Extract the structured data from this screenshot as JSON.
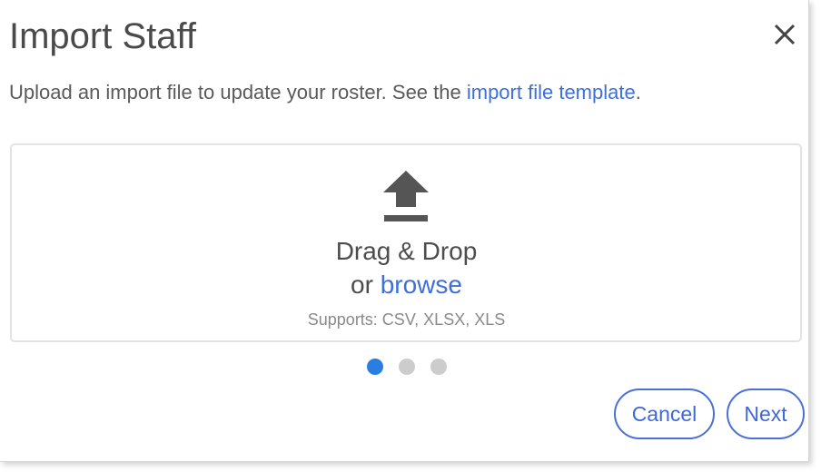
{
  "dialog": {
    "title": "Import Staff",
    "close_icon": "close-icon",
    "subtitle_text": "Upload an import file to update your roster. See the ",
    "subtitle_link": "import file template",
    "subtitle_end": "."
  },
  "dropzone": {
    "icon": "upload-icon",
    "drag_text": "Drag & Drop",
    "or_text": "or",
    "browse_link": "browse",
    "supports": "Supports: CSV, XLSX, XLS"
  },
  "steps": {
    "count": 3,
    "current": 1
  },
  "buttons": {
    "cancel": "Cancel",
    "next": "Next"
  },
  "colors": {
    "accent": "#3f6fd9",
    "active_dot": "#2a7de1",
    "inactive_dot": "#cccccc",
    "title_text": "#4a4a4a"
  }
}
